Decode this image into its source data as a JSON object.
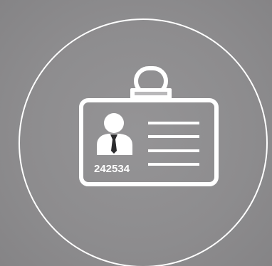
{
  "badge": {
    "number": "242534"
  },
  "icons": {
    "outer": "circle-outline-icon",
    "badge": "id-badge-icon",
    "clip": "badge-clip-icon",
    "person": "person-icon",
    "lines": "text-lines-icon"
  },
  "colors": {
    "background": "#8e8d8f",
    "foreground": "#ffffff"
  }
}
